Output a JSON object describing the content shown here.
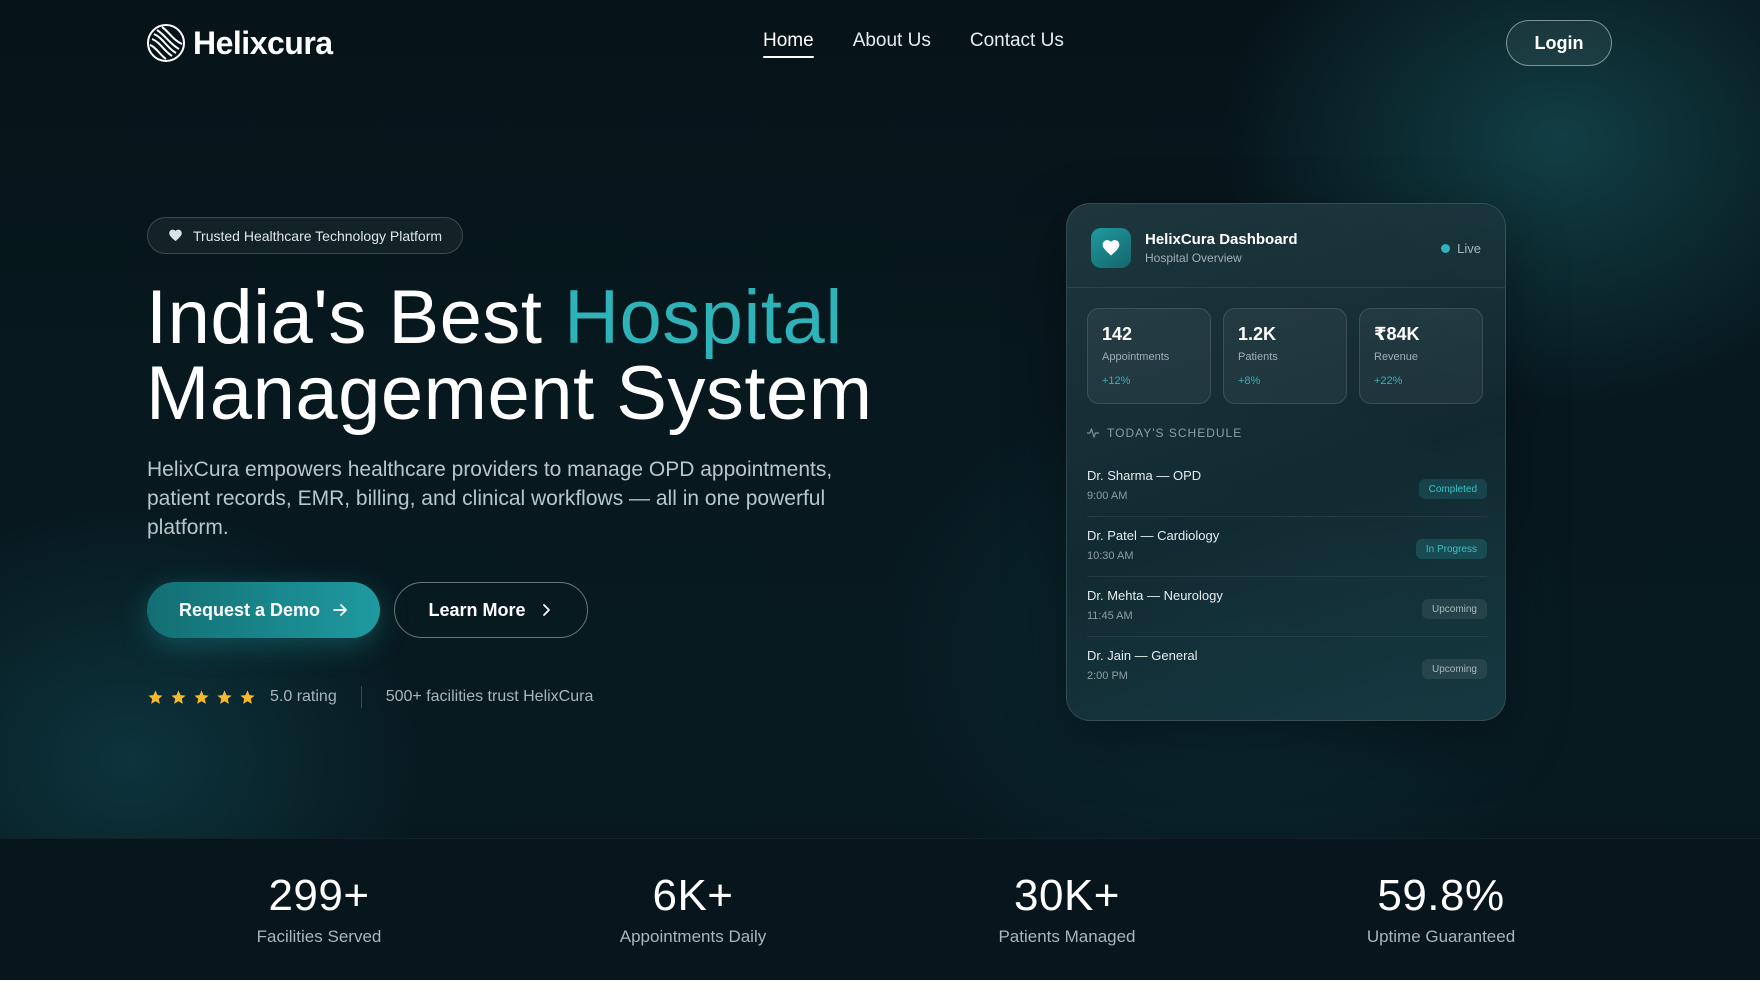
{
  "brand": {
    "name": "Helixcura"
  },
  "nav": {
    "links": [
      {
        "label": "Home",
        "active": true
      },
      {
        "label": "About Us",
        "active": false
      },
      {
        "label": "Contact Us",
        "active": false
      }
    ],
    "login_label": "Login"
  },
  "hero": {
    "badge": "Trusted Healthcare Technology Platform",
    "title_part1": "India's Best ",
    "title_accent": "Hospital",
    "title_line2": "Management System",
    "description": "HelixCura empowers healthcare providers to manage OPD appointments, patient records, EMR, billing, and clinical workflows — all in one powerful platform.",
    "primary_cta": "Request a Demo",
    "secondary_cta": "Learn More",
    "rating": {
      "stars": 5,
      "text": "5.0 rating"
    },
    "trust": "500+ facilities trust HelixCura"
  },
  "dashboard": {
    "title": "HelixCura Dashboard",
    "subtitle": "Hospital Overview",
    "status": "Live",
    "stats": [
      {
        "value": "142",
        "label": "Appointments",
        "change": "+12%"
      },
      {
        "value": "1.2K",
        "label": "Patients",
        "change": "+8%"
      },
      {
        "value": "₹84K",
        "label": "Revenue",
        "change": "+22%"
      }
    ],
    "schedule_title": "TODAY'S SCHEDULE",
    "schedule": [
      {
        "name": "Dr. Sharma — OPD",
        "time": "9:00 AM",
        "status": "Completed"
      },
      {
        "name": "Dr. Patel — Cardiology",
        "time": "10:30 AM",
        "status": "In Progress"
      },
      {
        "name": "Dr. Mehta — Neurology",
        "time": "11:45 AM",
        "status": "Upcoming"
      },
      {
        "name": "Dr. Jain — General",
        "time": "2:00 PM",
        "status": "Upcoming"
      }
    ]
  },
  "band": [
    {
      "value": "299+",
      "label": "Facilities Served"
    },
    {
      "value": "6K+",
      "label": "Appointments Daily"
    },
    {
      "value": "30K+",
      "label": "Patients Managed"
    },
    {
      "value": "59.8%",
      "label": "Uptime Guaranteed"
    }
  ],
  "colors": {
    "accent": "#2fb3b8",
    "background": "#061419",
    "star": "#f5b82e"
  },
  "icons": {
    "logo": "helix-logo-icon",
    "badge": "heart-icon",
    "primary_cta": "arrow-right-icon",
    "secondary_cta": "chevron-right-icon",
    "dashboard_logo": "heart-icon",
    "schedule": "activity-icon",
    "rating": "star-icon"
  }
}
